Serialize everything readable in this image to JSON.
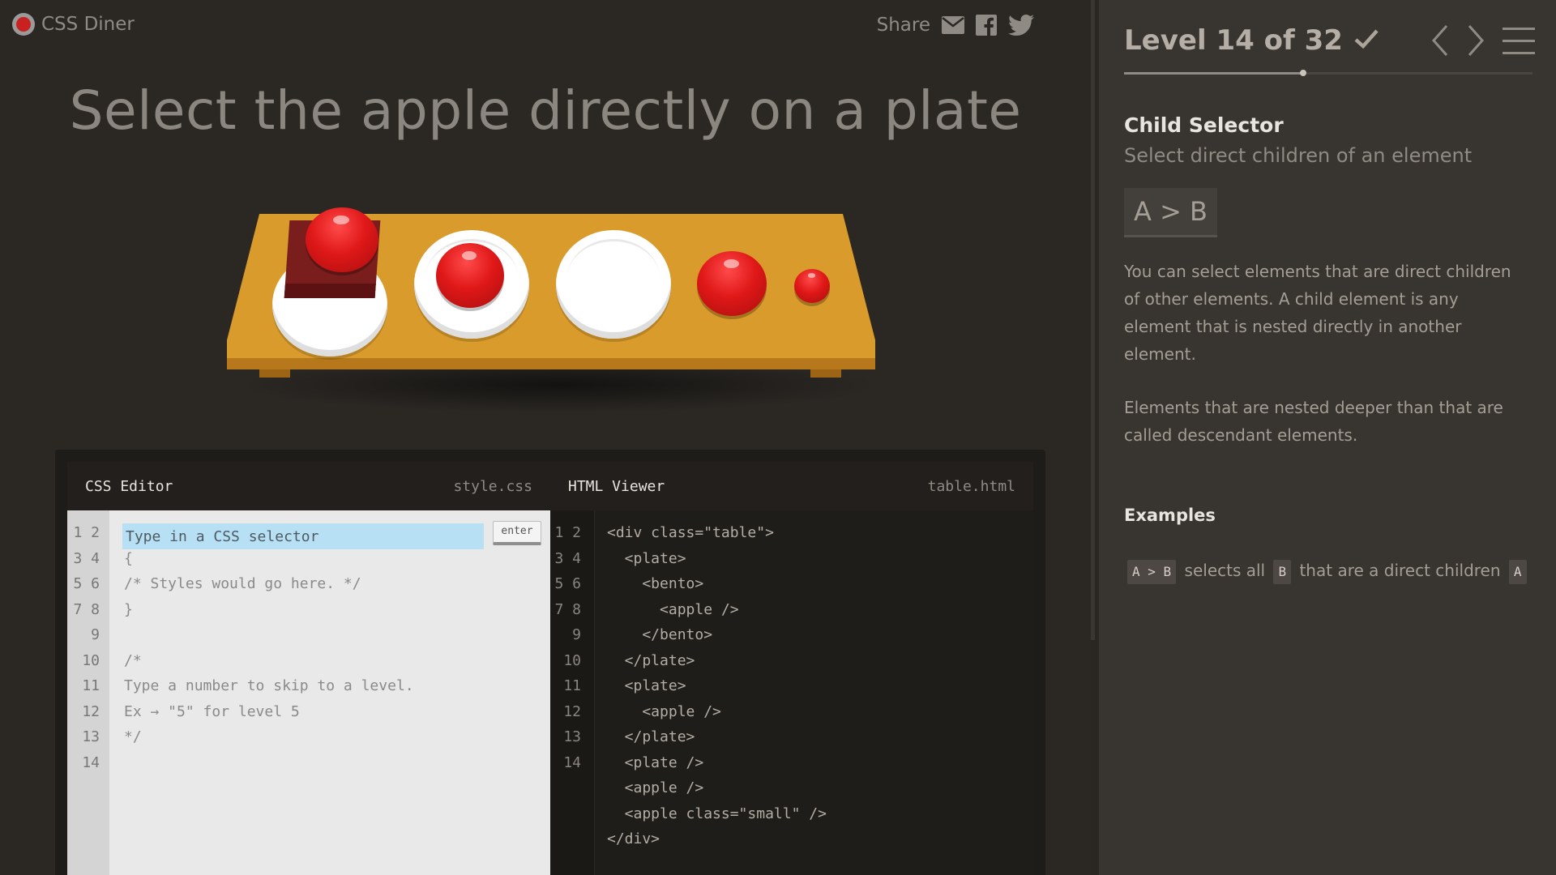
{
  "app": {
    "logo_text": "CSS Diner"
  },
  "share": {
    "label": "Share"
  },
  "instruction": "Select the apple directly on a plate",
  "css_editor": {
    "title": "CSS Editor",
    "filename": "style.css",
    "placeholder": "Type in a CSS selector",
    "enter_label": "enter",
    "line_numbers": "1\n2\n3\n4\n5\n6\n7\n8\n9\n10\n11\n12\n13\n14",
    "code": "\n{\n/* Styles would go here. */\n}\n\n/*\nType a number to skip to a level.\nEx → \"5\" for level 5\n*/"
  },
  "html_viewer": {
    "title": "HTML Viewer",
    "filename": "table.html",
    "line_numbers": "1\n2\n3\n4\n5\n6\n7\n8\n9\n10\n11\n12\n13\n14",
    "code": "<div class=\"table\">\n  <plate>\n    <bento>\n      <apple />\n    </bento>\n  </plate>\n  <plate>\n    <apple />\n  </plate>\n  <plate />\n  <apple />\n  <apple class=\"small\" />\n</div>"
  },
  "sidebar": {
    "level_title": "Level 14 of 32",
    "level_progress": 0.4375,
    "selector_name": "Child Selector",
    "selector_desc": "Select direct children of an element",
    "syntax": "A > B",
    "desc_p1": "You can select elements that are direct children of other elements. A child element is any element that is nested directly in another element.",
    "desc_p2": "Elements that are nested deeper than that are called descendant elements.",
    "examples_title": "Examples",
    "example": {
      "tag1": "A > B",
      "text1": "selects all",
      "tag2": "B",
      "text2": "that are a direct children",
      "tag3": "A"
    }
  },
  "colors": {
    "accent_red": "#e01818",
    "table_wood": "#d99b2b",
    "input_highlight": "#b7e0f5"
  }
}
